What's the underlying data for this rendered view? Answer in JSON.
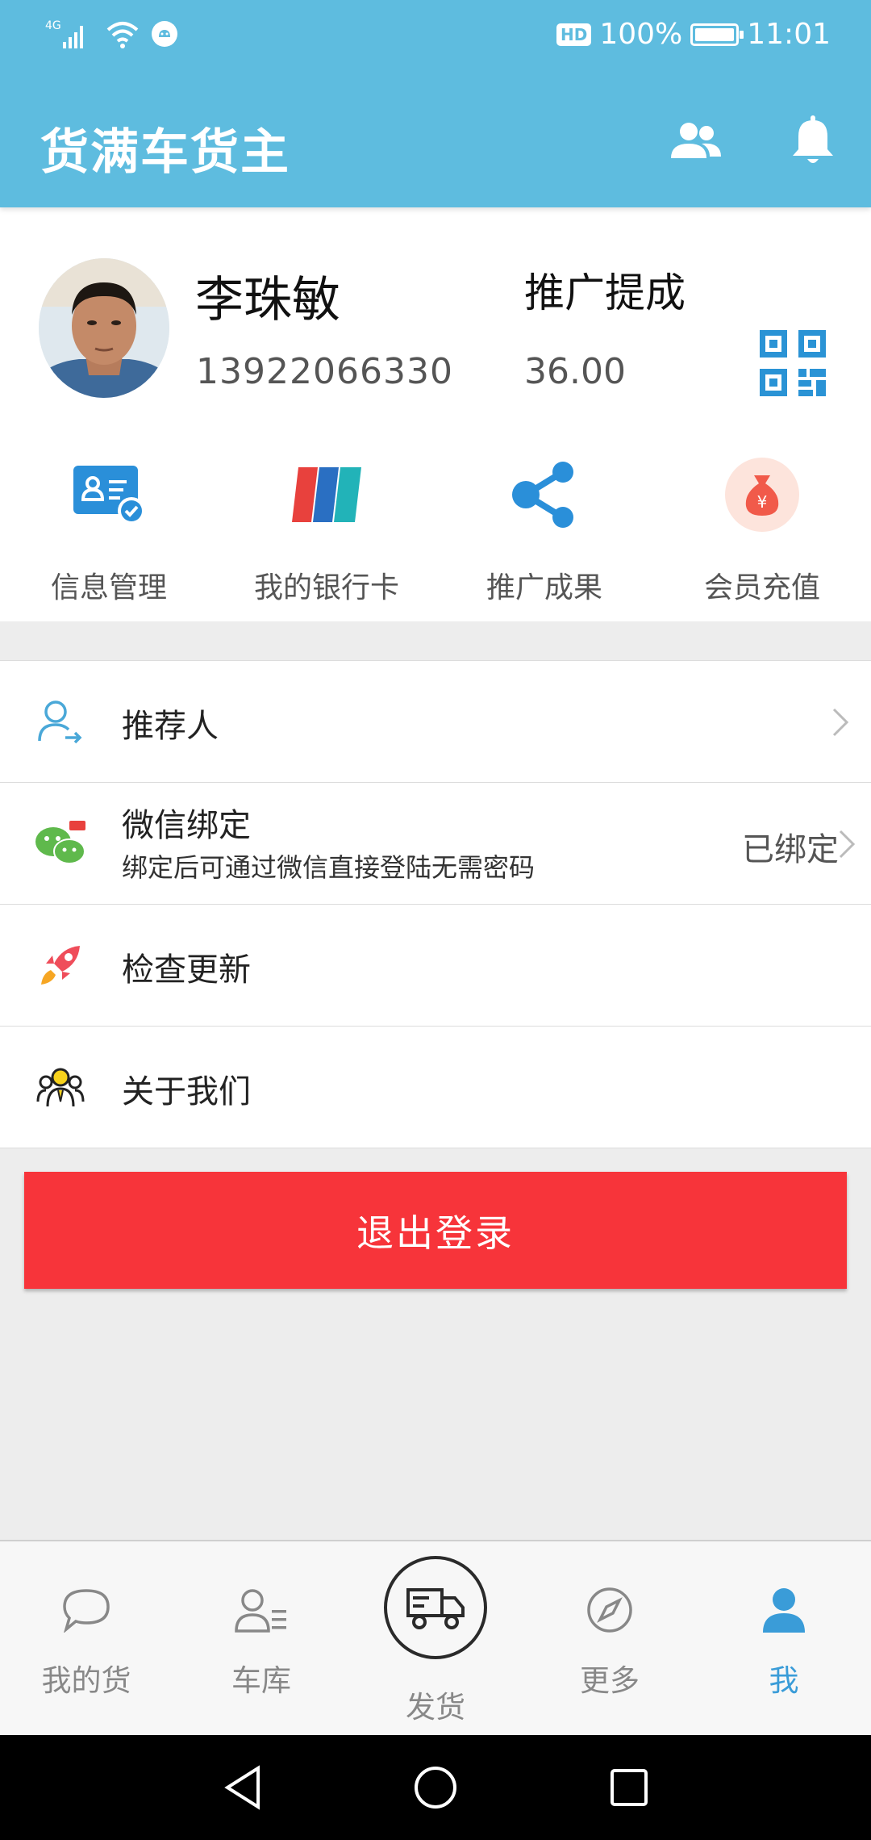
{
  "status_bar": {
    "network": "4G",
    "hd": "HD",
    "battery_text": "100%",
    "battery_level": 1.0,
    "time": "11:01"
  },
  "app_bar": {
    "title": "货满车货主",
    "icons": [
      "contacts-icon",
      "bell-icon"
    ]
  },
  "profile": {
    "name": "李珠敏",
    "phone": "13922066330",
    "promo_title": "推广提成",
    "promo_value": "36.00"
  },
  "quick_actions": [
    {
      "label": "信息管理",
      "icon": "id-card-icon"
    },
    {
      "label": "我的银行卡",
      "icon": "bank-card-icon"
    },
    {
      "label": "推广成果",
      "icon": "share-icon"
    },
    {
      "label": "会员充值",
      "icon": "money-bag-icon"
    }
  ],
  "list": [
    {
      "label": "推荐人",
      "icon": "referrer-icon"
    },
    {
      "label": "微信绑定",
      "sub": "绑定后可通过微信直接登陆无需密码",
      "status": "已绑定",
      "icon": "wechat-icon"
    },
    {
      "label": "检查更新",
      "icon": "rocket-icon"
    },
    {
      "label": "关于我们",
      "icon": "team-icon"
    }
  ],
  "logout_label": "退出登录",
  "tabs": [
    {
      "label": "我的货",
      "icon": "chat-bubble-icon"
    },
    {
      "label": "车库",
      "icon": "driver-list-icon"
    },
    {
      "label": "发货",
      "icon": "truck-icon"
    },
    {
      "label": "更多",
      "icon": "compass-icon"
    },
    {
      "label": "我",
      "icon": "person-icon",
      "active": true
    }
  ],
  "colors": {
    "primary": "#5ebcdf",
    "logout": "#f7343a",
    "active_tab": "#3a9cd8"
  }
}
